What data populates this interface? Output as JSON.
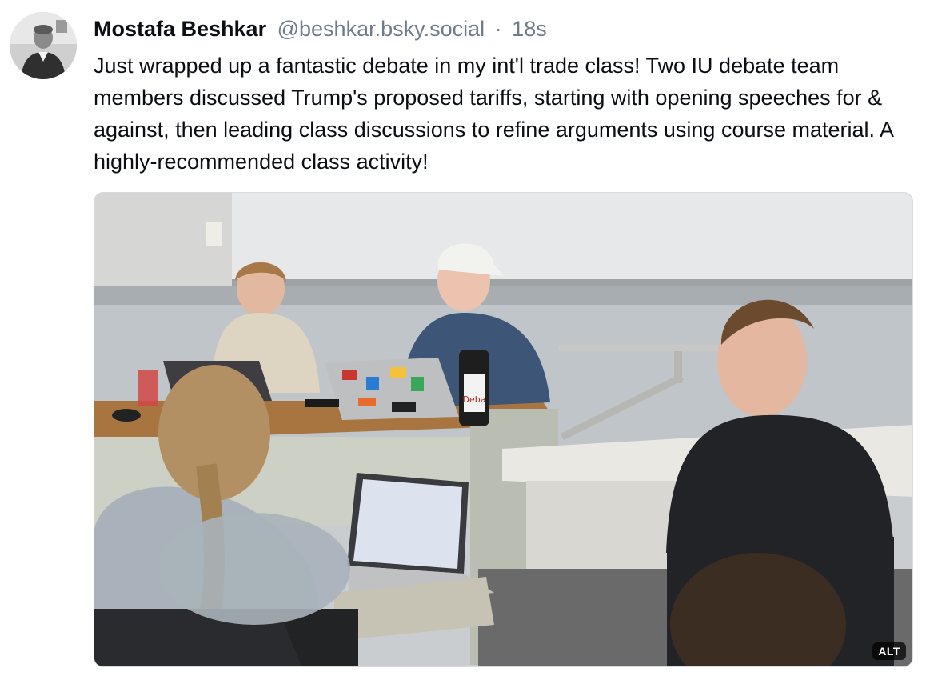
{
  "post": {
    "author_name": "Mostafa Beshkar",
    "author_handle": "@beshkar.bsky.social",
    "separator": "·",
    "timestamp": "18s",
    "text": "Just wrapped up a fantastic debate in my int'l trade class! Two IU debate team members discussed Trump's proposed tariffs, starting with opening speeches for & against, then leading class discussions to refine arguments using course material. A highly-recommended class activity!"
  },
  "media": {
    "alt_badge": "ALT",
    "bottle_logo_text": "Deba"
  },
  "colors": {
    "text": "#0b0f14",
    "muted": "#6f7c8b",
    "border": "#d4dbe2"
  },
  "icons": {
    "avatar": "profile-photo",
    "alt": "alt-text-badge"
  }
}
